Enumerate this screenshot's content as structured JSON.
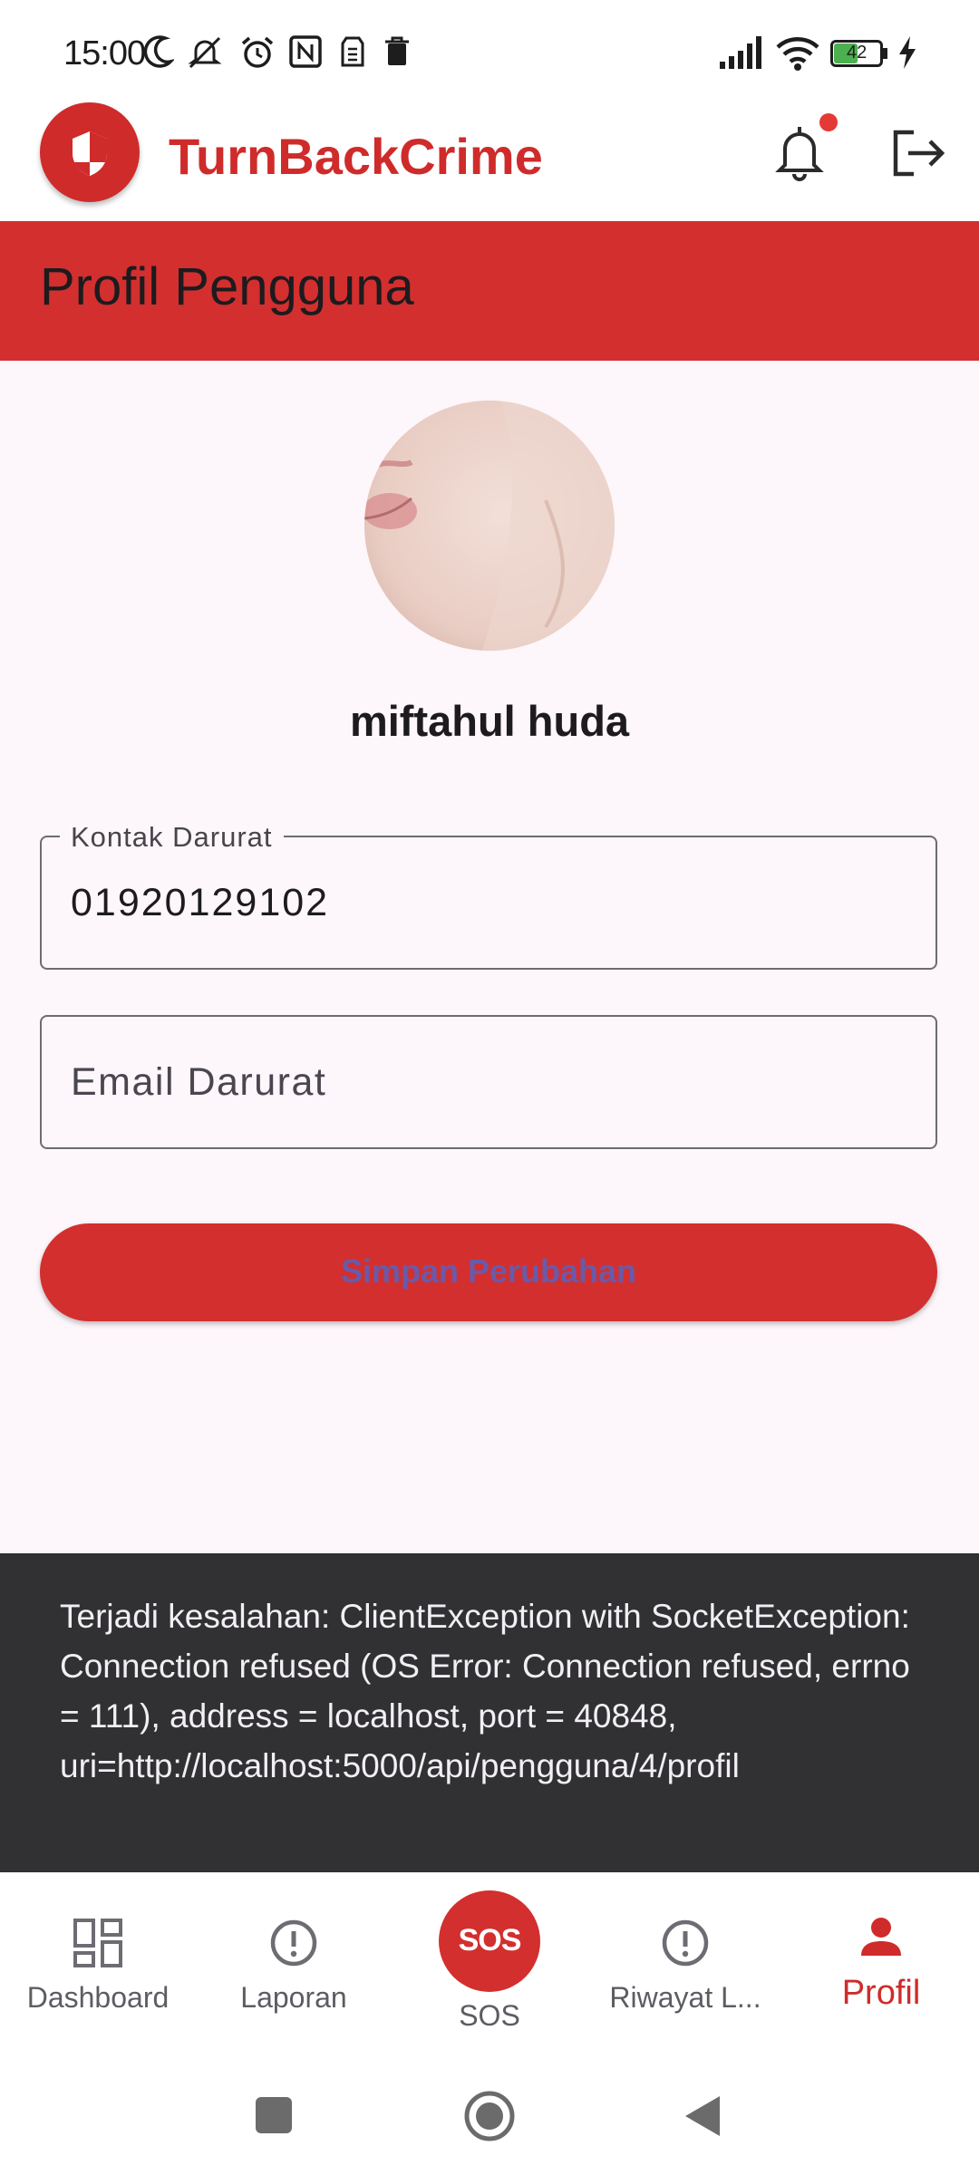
{
  "status_bar": {
    "time": "15:00",
    "battery_level": "42"
  },
  "app_bar": {
    "title": "TurnBackCrime"
  },
  "page": {
    "title": "Profil Pengguna"
  },
  "profile": {
    "name": "miftahul huda"
  },
  "form": {
    "kontak_label": "Kontak Darurat",
    "kontak_value": "01920129102",
    "email_placeholder": "Email Darurat",
    "save_label": "Simpan Perubahan"
  },
  "snackbar": {
    "message": "Terjadi kesalahan: ClientException with SocketException: Connection refused (OS Error: Connection refused, errno = 111), address = localhost, port = 40848, uri=http://localhost:5000/api/pengguna/4/profil"
  },
  "bottom_nav": {
    "items": [
      {
        "label": "Dashboard",
        "icon": "dashboard-icon"
      },
      {
        "label": "Laporan",
        "icon": "alert-circle-icon"
      },
      {
        "label": "SOS",
        "icon": "sos-icon",
        "badge": "SOS"
      },
      {
        "label": "Riwayat L...",
        "icon": "alert-circle-icon"
      },
      {
        "label": "Profil",
        "icon": "person-icon",
        "active": true
      }
    ]
  },
  "colors": {
    "brand_red": "#d32f2f",
    "active_nav": "#cf2b2b"
  }
}
